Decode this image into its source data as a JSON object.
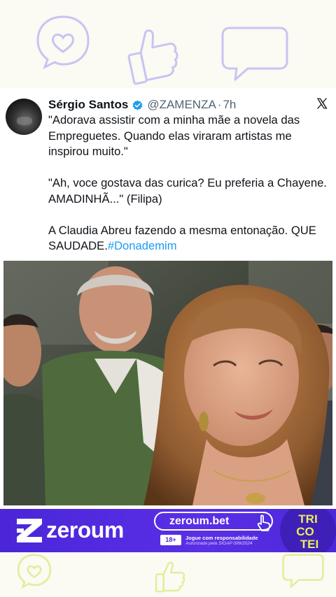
{
  "tweet": {
    "author_name": "Sérgio Santos",
    "author_handle": "@ZAMENZA",
    "separator": "·",
    "time": "7h",
    "paragraph_1": "\"Adorava assistir com a minha mãe a novela das Empreguetes. Quando elas viraram artistas me inspirou muito.\"",
    "paragraph_2": "\"Ah, voce gostava das curica? Eu preferia a Chayene. AMADINHÃ...\" (Filipa)",
    "paragraph_3": "A Claudia Abreu fazendo a mesma entonação. QUE SAUDADE.",
    "hashtag": "#Donademim"
  },
  "ad": {
    "brand": "zeroum",
    "url": "zeroum.bet",
    "age_badge": "18+",
    "responsible_line": "Jogue com responsabilidade",
    "authorization_line": "Autorizada pela SIGAP 099/2024",
    "tricotei_lines": [
      "TRI",
      "CO",
      "TEI"
    ]
  },
  "colors": {
    "verified": "#1d9bf0",
    "hashtag": "#1d9bf0",
    "ad_background": "#5029dd",
    "decor_lilac": "#c8c4f2",
    "decor_lime": "#e4ec9a"
  },
  "icons": [
    "heart-bubble-icon",
    "thumbs-up-icon",
    "speech-bubble-icon",
    "verified-badge-icon",
    "x-logo-icon"
  ]
}
